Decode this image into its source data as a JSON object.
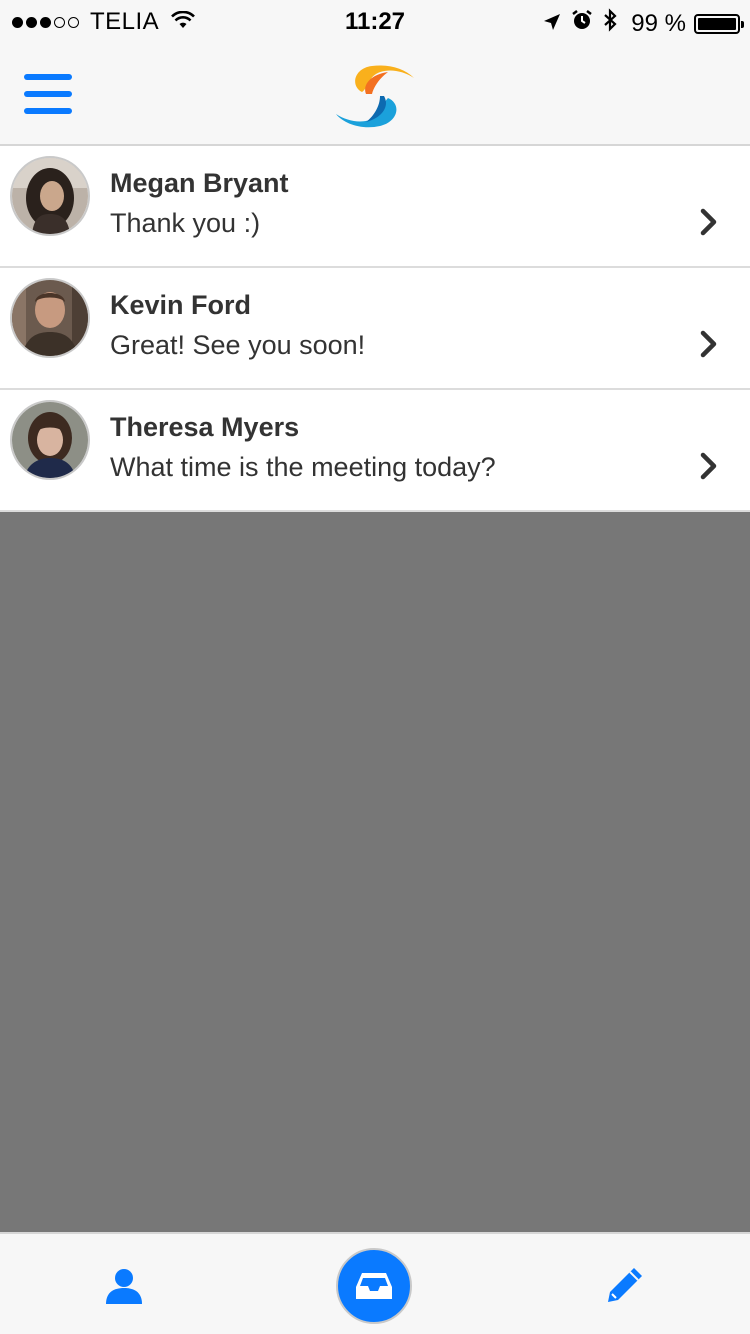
{
  "status_bar": {
    "signal_bars_filled": 3,
    "signal_bars_total": 5,
    "carrier": "TELIA",
    "time": "11:27",
    "battery_percent": "99 %",
    "battery_level": 0.99,
    "icons": [
      "wifi-icon",
      "location-arrow-icon",
      "alarm-icon",
      "bluetooth-icon",
      "battery-icon"
    ]
  },
  "nav": {
    "menu_icon": "hamburger-menu-icon",
    "logo": "app-logo-swirl"
  },
  "conversations": [
    {
      "name": "Megan Bryant",
      "message": "Thank you :)"
    },
    {
      "name": "Kevin Ford",
      "message": "Great! See you soon!"
    },
    {
      "name": "Theresa Myers",
      "message": "What time is the meeting today?"
    }
  ],
  "tabs": [
    {
      "icon": "user-icon",
      "active": false
    },
    {
      "icon": "inbox-icon",
      "active": true
    },
    {
      "icon": "pencil-icon",
      "active": false
    }
  ],
  "colors": {
    "accent": "#0a7aff",
    "text": "#333333",
    "empty_area": "#777777",
    "bar_background": "#f7f7f7"
  }
}
